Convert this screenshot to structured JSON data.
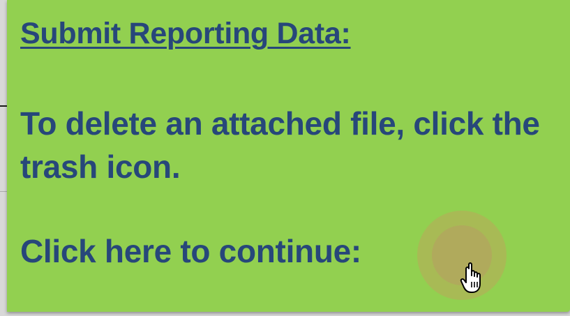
{
  "callout": {
    "title": "Submit Reporting Data:",
    "instruction": "To delete an attached file, click the trash icon.",
    "continue_label": "Click here to continue:",
    "continue_icon": "hand-pointer-icon",
    "background_color": "#92d050",
    "text_color": "#27477a",
    "button_color": "#b0aa5c"
  }
}
